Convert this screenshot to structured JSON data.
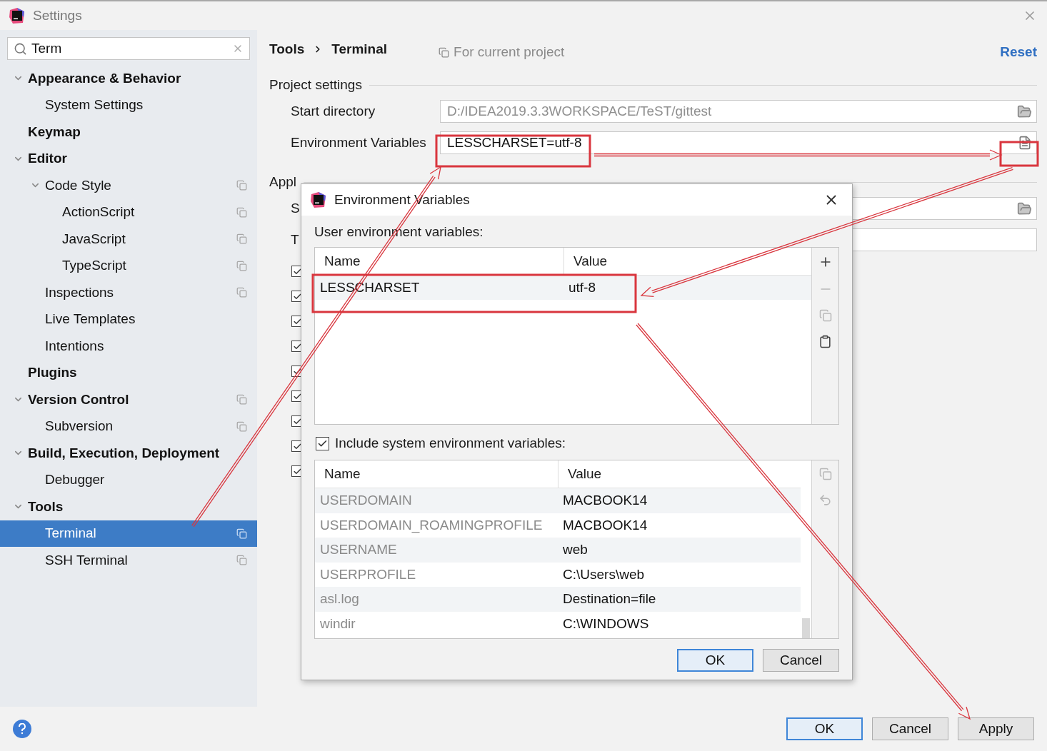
{
  "window": {
    "title": "Settings"
  },
  "sidebar": {
    "search": {
      "value": "Term"
    },
    "items": [
      {
        "label": "Appearance & Behavior",
        "expanded": true,
        "project_scope": false,
        "selected": false,
        "children": [
          {
            "label": "System Settings",
            "project_scope": false,
            "selected": false
          }
        ]
      },
      {
        "label": "Keymap",
        "project_scope": false,
        "selected": false
      },
      {
        "label": "Editor",
        "expanded": true,
        "project_scope": false,
        "selected": false,
        "children": [
          {
            "label": "Code Style",
            "expanded": true,
            "project_scope": true,
            "selected": false,
            "children": [
              {
                "label": "ActionScript",
                "project_scope": true,
                "selected": false
              },
              {
                "label": "JavaScript",
                "project_scope": true,
                "selected": false
              },
              {
                "label": "TypeScript",
                "project_scope": true,
                "selected": false
              }
            ]
          },
          {
            "label": "Inspections",
            "project_scope": true,
            "selected": false
          },
          {
            "label": "Live Templates",
            "project_scope": false,
            "selected": false
          },
          {
            "label": "Intentions",
            "project_scope": false,
            "selected": false
          }
        ]
      },
      {
        "label": "Plugins",
        "project_scope": false,
        "selected": false
      },
      {
        "label": "Version Control",
        "expanded": true,
        "project_scope": true,
        "selected": false,
        "children": [
          {
            "label": "Subversion",
            "project_scope": true,
            "selected": false
          }
        ]
      },
      {
        "label": "Build, Execution, Deployment",
        "expanded": true,
        "project_scope": false,
        "selected": false,
        "children": [
          {
            "label": "Debugger",
            "project_scope": false,
            "selected": false
          }
        ]
      },
      {
        "label": "Tools",
        "expanded": true,
        "project_scope": false,
        "selected": false,
        "children": [
          {
            "label": "Terminal",
            "project_scope": true,
            "selected": true
          },
          {
            "label": "SSH Terminal",
            "project_scope": true,
            "selected": false
          }
        ]
      }
    ]
  },
  "header": {
    "breadcrumb": [
      "Tools",
      "Terminal"
    ],
    "scope": "For current project",
    "reset": "Reset"
  },
  "project_settings": {
    "title": "Project settings",
    "fields": [
      {
        "label": "Start directory",
        "placeholder": "D:/IDEA2019.3.3WORKSPACE/TeST/gittest",
        "kind": "path"
      },
      {
        "label": "Environment Variables",
        "value": "LESSCHARSET=utf-8",
        "kind": "env"
      }
    ]
  },
  "application_settings": {
    "title": "Appl",
    "fields": [
      {
        "label": "S",
        "kind": "path"
      },
      {
        "label": "T",
        "kind": "text"
      }
    ],
    "checkboxes": [
      {
        "checked": true
      },
      {
        "checked": true
      },
      {
        "checked": true
      },
      {
        "checked": true
      },
      {
        "checked": true
      },
      {
        "checked": true
      },
      {
        "checked": true
      },
      {
        "checked": true
      },
      {
        "checked": true
      }
    ]
  },
  "dialog": {
    "title": "Environment Variables",
    "user_variables": {
      "label": "User environment variables:",
      "columns": [
        "Name",
        "Value"
      ],
      "rows": [
        {
          "name": "LESSCHARSET",
          "value": "utf-8"
        }
      ],
      "tools": [
        {
          "kind": "add",
          "disabled": false
        },
        {
          "kind": "remove",
          "disabled": true
        },
        {
          "kind": "copy",
          "disabled": true
        },
        {
          "kind": "paste",
          "disabled": false
        }
      ]
    },
    "include_system": {
      "label": "Include system environment variables:",
      "checked": true
    },
    "system_variables": {
      "columns": [
        "Name",
        "Value"
      ],
      "rows": [
        {
          "name": "USERDOMAIN",
          "value": "MACBOOK14"
        },
        {
          "name": "USERDOMAIN_ROAMINGPROFILE",
          "value": "MACBOOK14"
        },
        {
          "name": "USERNAME",
          "value": "web"
        },
        {
          "name": "USERPROFILE",
          "value": "C:\\Users\\web"
        },
        {
          "name": "asl.log",
          "value": "Destination=file"
        },
        {
          "name": "windir",
          "value": "C:\\WINDOWS"
        }
      ],
      "tools": [
        {
          "kind": "copy",
          "disabled": true
        },
        {
          "kind": "undo",
          "disabled": true
        }
      ]
    },
    "buttons": [
      {
        "label": "OK",
        "default": true
      },
      {
        "label": "Cancel",
        "default": false
      }
    ]
  },
  "footer": {
    "buttons": [
      {
        "label": "OK",
        "default": true
      },
      {
        "label": "Cancel",
        "default": false
      },
      {
        "label": "Apply",
        "default": false
      }
    ]
  },
  "annotations": [
    {
      "kind": "frame"
    },
    {
      "kind": "frame"
    },
    {
      "kind": "frame"
    },
    {
      "kind": "arrow"
    },
    {
      "kind": "arrow"
    },
    {
      "kind": "arrow"
    },
    {
      "kind": "arrow"
    }
  ]
}
